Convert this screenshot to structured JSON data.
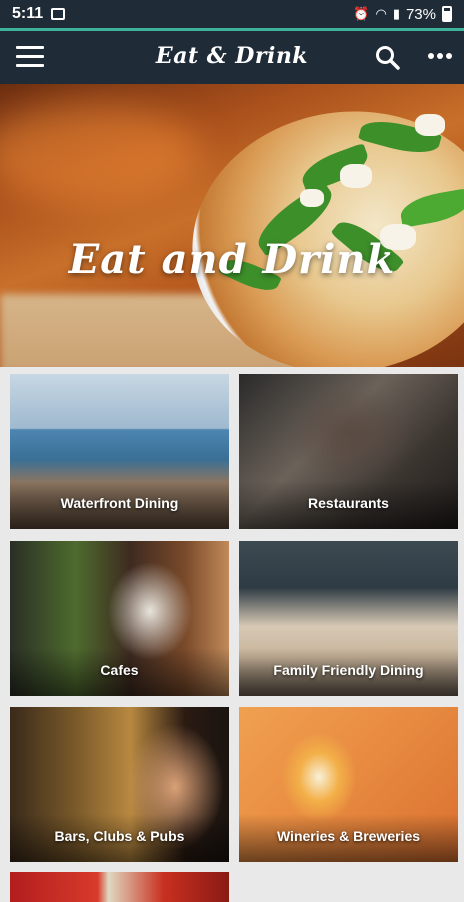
{
  "status_bar": {
    "time": "5:11",
    "battery": "73%"
  },
  "app_bar": {
    "title": "Eat & Drink"
  },
  "hero": {
    "title": "Eat and Drink"
  },
  "categories": [
    {
      "label": "Waterfront Dining"
    },
    {
      "label": "Restaurants"
    },
    {
      "label": "Cafes"
    },
    {
      "label": "Family Friendly Dining"
    },
    {
      "label": "Bars, Clubs & Pubs"
    },
    {
      "label": "Wineries & Breweries"
    }
  ],
  "colors": {
    "app_bar": "#1f2b37",
    "accent": "#3cb39a"
  },
  "icons": [
    "menu-icon",
    "search-icon",
    "more-options-icon",
    "image-notification-icon",
    "battery-icon"
  ]
}
